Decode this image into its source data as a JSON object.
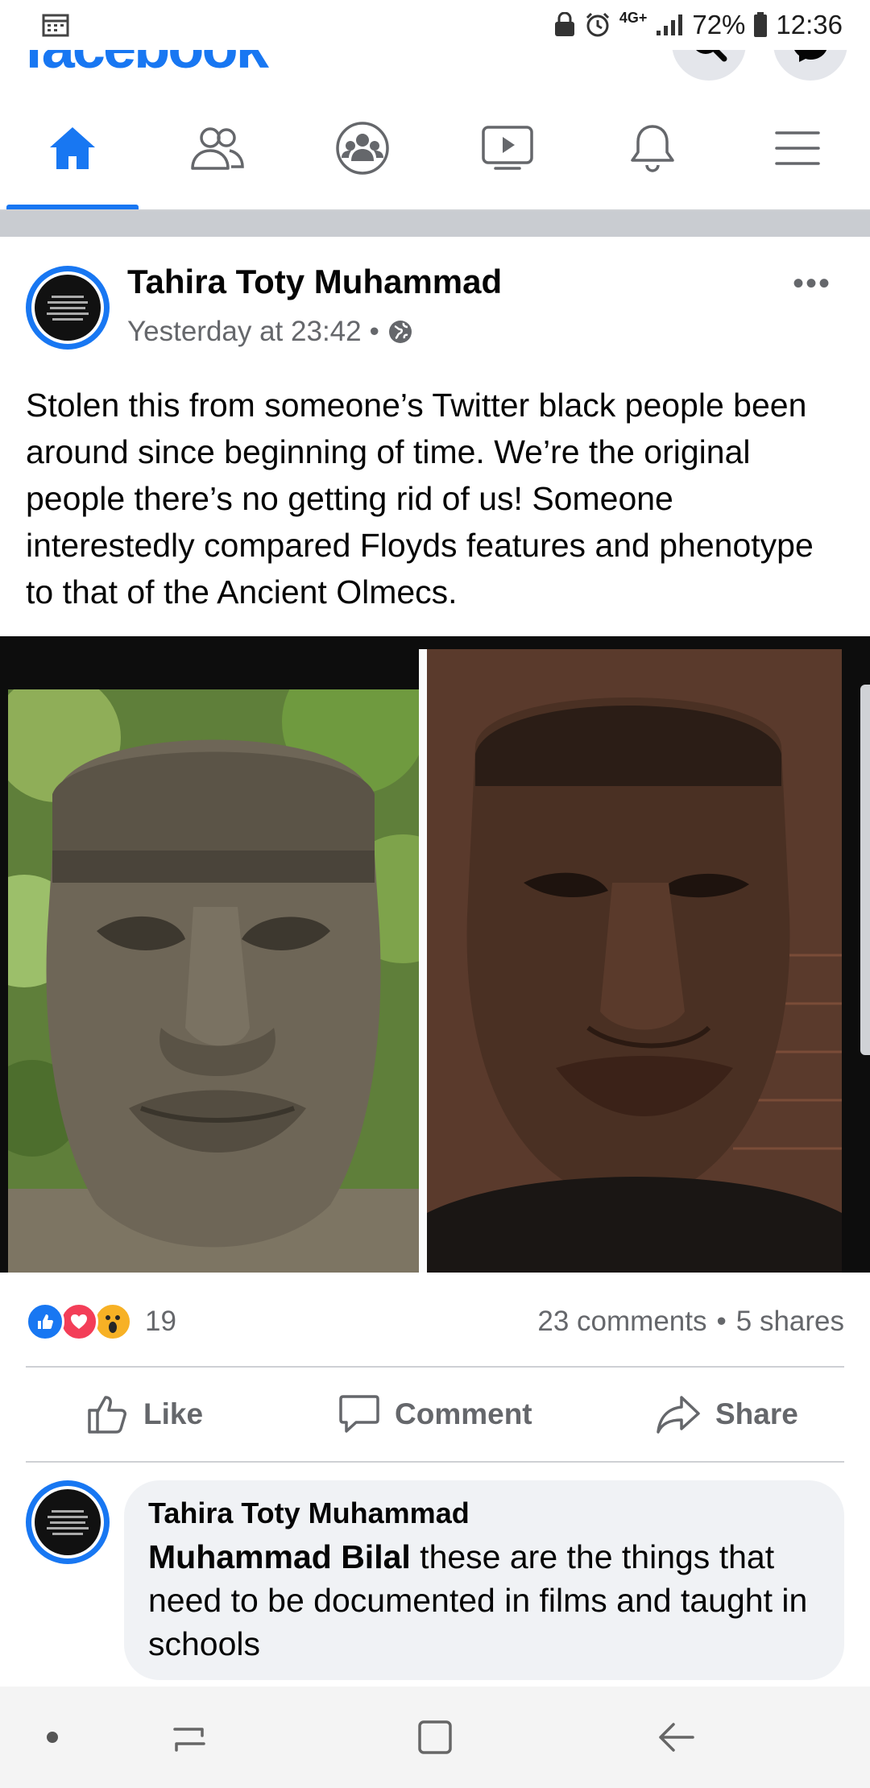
{
  "status_bar": {
    "network": "4G+",
    "battery": "72%",
    "time": "12:36"
  },
  "header": {
    "logo": "facebook"
  },
  "post": {
    "author": "Tahira Toty Muhammad",
    "timestamp": "Yesterday at 23:42",
    "separator": "•",
    "text": "Stolen this from someone’s Twitter black people been around since beginning of time. We’re the original people there’s no getting rid of us! Someone interestedly compared Floyds features and phenotype to that of the Ancient Olmecs.",
    "more": "•••",
    "reaction_count": "19",
    "comments": "23 comments",
    "stats_separator": "•",
    "shares": "5 shares"
  },
  "actions": {
    "like": "Like",
    "comment": "Comment",
    "share": "Share"
  },
  "comment": {
    "author": "Tahira Toty Muhammad",
    "mention": "Muhammad Bilal",
    "text": " these are the things that need to be documented in films and taught in schools"
  },
  "colors": {
    "brand": "#1877f2",
    "secondary_text": "#65676b",
    "bubble": "#f0f2f5"
  }
}
